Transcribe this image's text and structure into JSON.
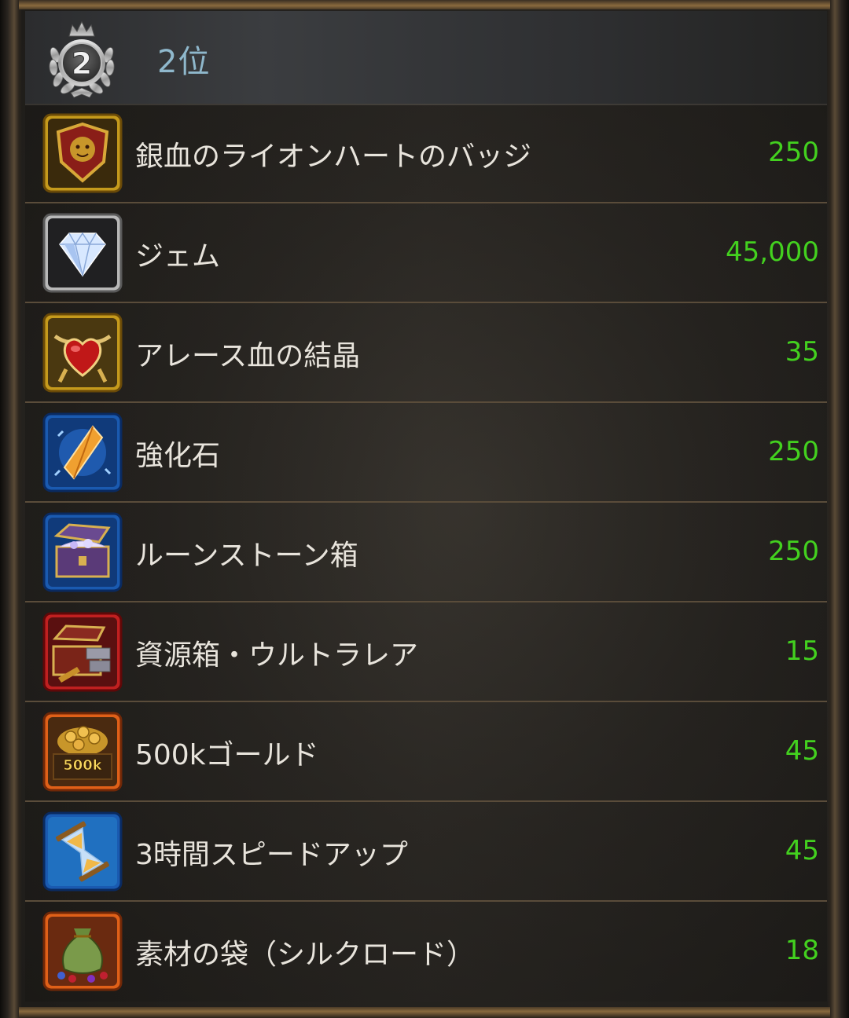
{
  "header": {
    "rank_number": "2",
    "rank_label": "2位"
  },
  "colors": {
    "quantity": "#43d11f",
    "name_text": "#e8e4dc",
    "rank_label": "#8fb8cc"
  },
  "rewards": [
    {
      "name": "銀血のライオンハートのバッジ",
      "quantity": "250",
      "icon": "lion-badge-icon",
      "frame": "gold"
    },
    {
      "name": "ジェム",
      "quantity": "45,000",
      "icon": "gem-icon",
      "frame": "silver"
    },
    {
      "name": "アレース血の結晶",
      "quantity": "35",
      "icon": "blood-crystal-icon",
      "frame": "gold"
    },
    {
      "name": "強化石",
      "quantity": "250",
      "icon": "enhancement-stone-icon",
      "frame": "blue"
    },
    {
      "name": "ルーンストーン箱",
      "quantity": "250",
      "icon": "runestone-chest-icon",
      "frame": "blue"
    },
    {
      "name": "資源箱・ウルトラレア",
      "quantity": "15",
      "icon": "resource-chest-icon",
      "frame": "red"
    },
    {
      "name": "500kゴールド",
      "quantity": "45",
      "icon": "gold-coins-icon",
      "frame": "orange",
      "icon_text": "500k"
    },
    {
      "name": "3時間スピードアップ",
      "quantity": "45",
      "icon": "hourglass-icon",
      "frame": "blue"
    },
    {
      "name": "素材の袋（シルクロード）",
      "quantity": "18",
      "icon": "material-bag-icon",
      "frame": "orange"
    }
  ]
}
